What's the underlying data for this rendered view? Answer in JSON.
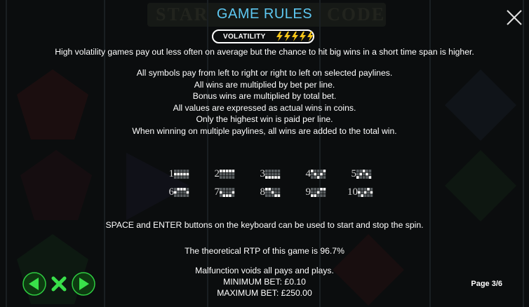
{
  "header": {
    "title": "GAME RULES",
    "close_icon": "close-icon"
  },
  "volatility": {
    "label": "VOLATILITY",
    "level": 5,
    "max": 5,
    "icon": "lightning-icon",
    "color": "#f5c518"
  },
  "background_banner": {
    "left_word": "STAR",
    "right_word": "CODE"
  },
  "rules": {
    "volatility_text": "High volatility games pay out less often on average but the chance to hit big wins in a short time span is higher.",
    "lines": [
      "All symbols pay from left to right or right to left on selected paylines.",
      "All wins are multiplied by bet per line.",
      "Bonus wins are multiplied by total bet.",
      "All values are expressed as actual wins in coins.",
      "Only the highest win is paid per line.",
      "When winning on multiple paylines, all wins are added to the total win."
    ],
    "keyboard_text": "SPACE and ENTER buttons on the keyboard can be used to start and stop the spin.",
    "rtp_text": "The theoretical RTP of this game is 96.7%",
    "malfunction_text": "Malfunction voids all pays and plays.",
    "min_bet_text": "MINIMUM BET: £0.10",
    "max_bet_text": "MAXIMUM BET: £250.00"
  },
  "paylines": [
    {
      "number": "1",
      "rows": [
        1,
        1,
        1,
        1,
        1
      ]
    },
    {
      "number": "2",
      "rows": [
        0,
        0,
        0,
        0,
        0
      ]
    },
    {
      "number": "3",
      "rows": [
        2,
        2,
        2,
        2,
        2
      ]
    },
    {
      "number": "4",
      "rows": [
        0,
        1,
        2,
        1,
        0
      ]
    },
    {
      "number": "5",
      "rows": [
        2,
        1,
        0,
        1,
        2
      ]
    },
    {
      "number": "6",
      "rows": [
        1,
        0,
        0,
        0,
        1
      ]
    },
    {
      "number": "7",
      "rows": [
        1,
        2,
        2,
        2,
        1
      ]
    },
    {
      "number": "8",
      "rows": [
        0,
        0,
        1,
        2,
        2
      ]
    },
    {
      "number": "9",
      "rows": [
        2,
        2,
        1,
        0,
        0
      ]
    },
    {
      "number": "10",
      "rows": [
        1,
        2,
        1,
        0,
        1
      ]
    }
  ],
  "footer": {
    "prev_icon": "arrow-left-icon",
    "close_icon": "x-icon",
    "next_icon": "arrow-right-icon",
    "page_label": "Page 3/6",
    "accent": "#2ecc40"
  }
}
